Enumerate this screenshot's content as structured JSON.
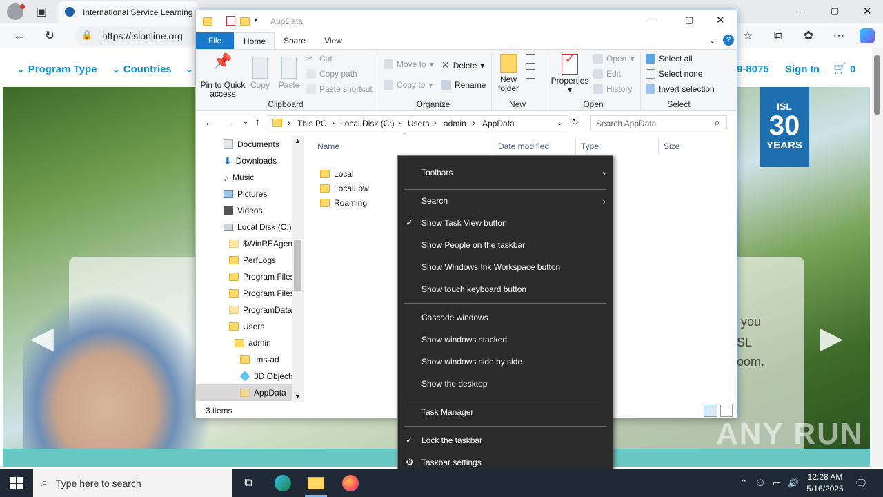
{
  "browser": {
    "tab_title": "International Service Learning",
    "url": "https://islonline.org",
    "window_controls": [
      "–",
      "▢",
      "✕"
    ]
  },
  "site": {
    "nav": [
      "Program Type",
      "Countries"
    ],
    "phone": "9-8075",
    "signin": "Sign In",
    "cart_count": "0",
    "badge_top": "ISL",
    "badge_num": "30",
    "badge_bottom": "YEARS",
    "hero_fragments": [
      "e.",
      "y you",
      "SL",
      "oom."
    ]
  },
  "explorer": {
    "title": "AppData",
    "tabs": [
      "File",
      "Home",
      "Share",
      "View"
    ],
    "ribbon": {
      "clipboard": {
        "label": "Clipboard",
        "pin": "Pin to Quick access",
        "copy": "Copy",
        "paste": "Paste",
        "cut": "Cut",
        "copy_path": "Copy path",
        "paste_shortcut": "Paste shortcut"
      },
      "organize": {
        "label": "Organize",
        "move_to": "Move to",
        "copy_to": "Copy to",
        "delete": "Delete",
        "rename": "Rename"
      },
      "new": {
        "label": "New",
        "new_folder": "New folder"
      },
      "open": {
        "label": "Open",
        "properties": "Properties",
        "open": "Open",
        "edit": "Edit",
        "history": "History"
      },
      "select": {
        "label": "Select",
        "select_all": "Select all",
        "select_none": "Select none",
        "invert": "Invert selection"
      }
    },
    "breadcrumb": [
      "This PC",
      "Local Disk (C:)",
      "Users",
      "admin",
      "AppData"
    ],
    "search_placeholder": "Search AppData",
    "tree": [
      "Documents",
      "Downloads",
      "Music",
      "Pictures",
      "Videos",
      "Local Disk (C:)",
      "$WinREAgent",
      "PerfLogs",
      "Program Files",
      "Program Files",
      "ProgramData",
      "Users",
      "admin",
      ".ms-ad",
      "3D Objects",
      "AppData"
    ],
    "columns": [
      "Name",
      "Date modified",
      "Type",
      "Size"
    ],
    "files": [
      "Local",
      "LocalLow",
      "Roaming"
    ],
    "status": "3 items"
  },
  "context_menu": {
    "items": [
      {
        "label": "Toolbars",
        "arrow": "›"
      },
      {
        "label": "Search",
        "arrow": "›"
      },
      {
        "label": "Show Task View button",
        "check": "✓"
      },
      {
        "label": "Show People on the taskbar"
      },
      {
        "label": "Show Windows Ink Workspace button"
      },
      {
        "label": "Show touch keyboard button"
      },
      {
        "label": "Cascade windows"
      },
      {
        "label": "Show windows stacked"
      },
      {
        "label": "Show windows side by side"
      },
      {
        "label": "Show the desktop"
      },
      {
        "label": "Task Manager"
      },
      {
        "label": "Lock the taskbar",
        "check": "✓"
      },
      {
        "label": "Taskbar settings",
        "icon": "⚙"
      }
    ]
  },
  "taskbar": {
    "search_placeholder": "Type here to search",
    "time": "12:28 AM",
    "date": "5/16/2025"
  },
  "watermark": "ANY RUN"
}
